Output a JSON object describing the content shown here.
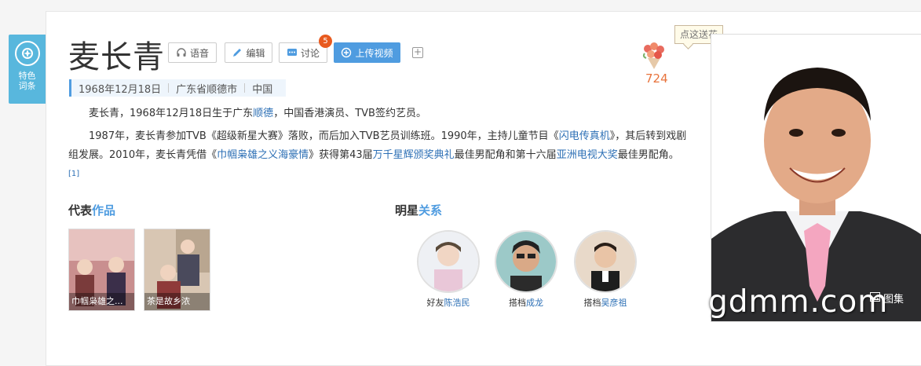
{
  "header": {
    "name": "麦长青",
    "badge_label_1": "特色",
    "badge_label_2": "词条"
  },
  "toolbar": {
    "voice": "语音",
    "edit": "编辑",
    "discuss": "讨论",
    "discuss_count": "5",
    "upload": "上传视频"
  },
  "meta": {
    "birth": "1968年12月18日",
    "place": "广东省顺德市",
    "country": "中国"
  },
  "intro": {
    "p1_a": "麦长青，1968年12月18日生于广东",
    "p1_link": "顺德",
    "p1_b": "，中国香港演员、TVB签约艺员。",
    "p2_a": "1987年，麦长青参加TVB《超级新星大赛》落败，而后加入TVB艺员训练班。1990年，主持儿童节目《",
    "p2_link1": "闪电传真机",
    "p2_b": "》，其后转到戏剧组发展。2010年，麦长青凭借《",
    "p2_link2": "巾帼枭雄之义海豪情",
    "p2_c": "》获得第43届",
    "p2_link3": "万千星辉颁奖典礼",
    "p2_d": "最佳男配角和第十六届",
    "p2_link4": "亚洲电视大奖",
    "p2_e": "最佳男配角。",
    "ref": "[1]"
  },
  "works": {
    "title_a": "代表",
    "title_b": "作品",
    "items": [
      {
        "caption": "巾帼枭雄之..."
      },
      {
        "caption": "茶是故乡浓"
      }
    ]
  },
  "relations": {
    "title_a": "明星",
    "title_b": "关系",
    "items": [
      {
        "rel": "好友",
        "name": "陈浩民"
      },
      {
        "rel": "搭档",
        "name": "成龙"
      },
      {
        "rel": "搭档",
        "name": "吴彦祖"
      }
    ]
  },
  "flower": {
    "count": "724",
    "tooltip": "点这送花"
  },
  "photo": {
    "album_label": "图集",
    "watermark": "gdmm.com"
  },
  "colors": {
    "accent": "#4f9ce0",
    "link": "#2c6fb5",
    "badge": "#e85a1f",
    "flower_count": "#e8733c"
  }
}
